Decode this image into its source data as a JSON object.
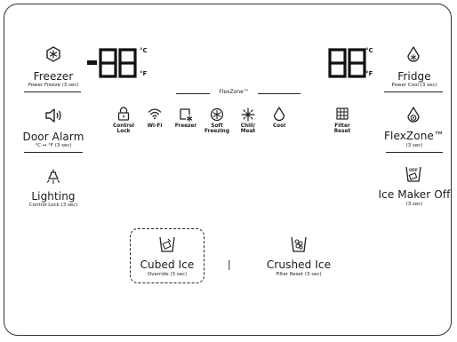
{
  "panel": {
    "freezer": {
      "label": "Freezer",
      "sublabel": "Power Freeze (3 sec)",
      "icon": "snowflake-icon"
    },
    "door_alarm": {
      "label": "Door Alarm",
      "sublabel": "°C ↔ °F (3 sec)",
      "icon": "speaker-icon"
    },
    "lighting": {
      "label": "Lighting",
      "sublabel": "Control Lock (3 sec)",
      "icon": "light-bulb-icon"
    },
    "fridge": {
      "label": "Fridge",
      "sublabel": "Power Cool (3 sec)",
      "icon": "water-drop-snowflake-icon"
    },
    "flexzone_btn": {
      "label": "FlexZone™",
      "sublabel": "(3 sec)",
      "icon": "water-drop-gear-icon"
    },
    "ice_maker": {
      "label": "Ice Maker Off",
      "sublabel": "(3 sec)",
      "icon": "ice-maker-off-icon",
      "icon_text": "OFF"
    },
    "cubed_ice": {
      "label": "Cubed Ice",
      "sublabel": "Override (3 sec)",
      "icon": "cubed-ice-cup-icon"
    },
    "crushed_ice": {
      "label": "Crushed Ice",
      "sublabel": "Filter Reset (3 sec)",
      "icon": "crushed-ice-cup-icon"
    },
    "freezer_display": {
      "sign": "-",
      "digits": "88",
      "unit_c": "°C",
      "unit_f": "°F"
    },
    "fridge_display": {
      "digits": "88",
      "unit_c": "°C",
      "unit_f": "°F"
    },
    "flexzone_header": "FlexZone™",
    "indicators": [
      {
        "label": "Control\nLock",
        "icon": "lock-icon"
      },
      {
        "label": "Wi-Fi",
        "icon": "wifi-icon"
      },
      {
        "label": "Freezer",
        "icon": "freezer-zone-icon"
      },
      {
        "label": "Soft\nFreezing",
        "icon": "soft-freezing-icon"
      },
      {
        "label": "Chill/\nMeat",
        "icon": "chill-meat-icon"
      },
      {
        "label": "Cool",
        "icon": "cool-drop-icon"
      },
      {
        "label": "Filter\nReset",
        "icon": "filter-grid-icon"
      }
    ],
    "separator": "|"
  }
}
